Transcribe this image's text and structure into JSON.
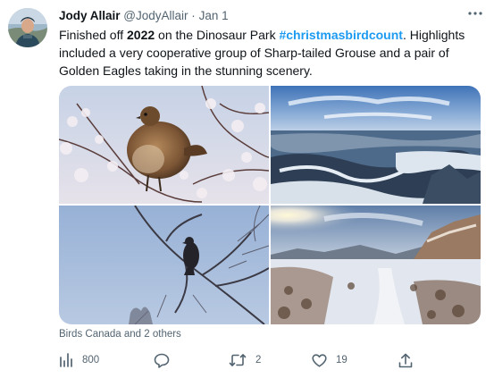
{
  "tweet": {
    "author_name": "Jody Allair",
    "author_handle": "@JodyAllair",
    "separator": "·",
    "date": "Jan 1",
    "text": {
      "part1": "Finished off ",
      "bold": "2022",
      "part2": " on the Dinosaur Park ",
      "hashtag": "#christmasbirdcount",
      "part3": ". Highlights included a very cooperative group of Sharp-tailed Grouse and a pair of Golden Eagles taking in the stunning scenery."
    },
    "media": [
      {
        "subject": "sharp-tailed grouse on frosted branches"
      },
      {
        "subject": "snowy badlands valley landscape"
      },
      {
        "subject": "golden eagle perched in bare tree"
      },
      {
        "subject": "snowy trail through badlands"
      }
    ],
    "tagged_users": "Birds Canada and 2 others",
    "stats": {
      "views": "800",
      "replies": "",
      "retweets": "2",
      "likes": "19"
    }
  },
  "icons": {
    "more": "more-horizontal-icon",
    "views": "analytics-icon",
    "reply": "reply-icon",
    "retweet": "retweet-icon",
    "like": "heart-icon",
    "share": "share-icon"
  },
  "colors": {
    "text": "#0f1419",
    "secondary": "#536471",
    "link": "#1d9bf0"
  }
}
